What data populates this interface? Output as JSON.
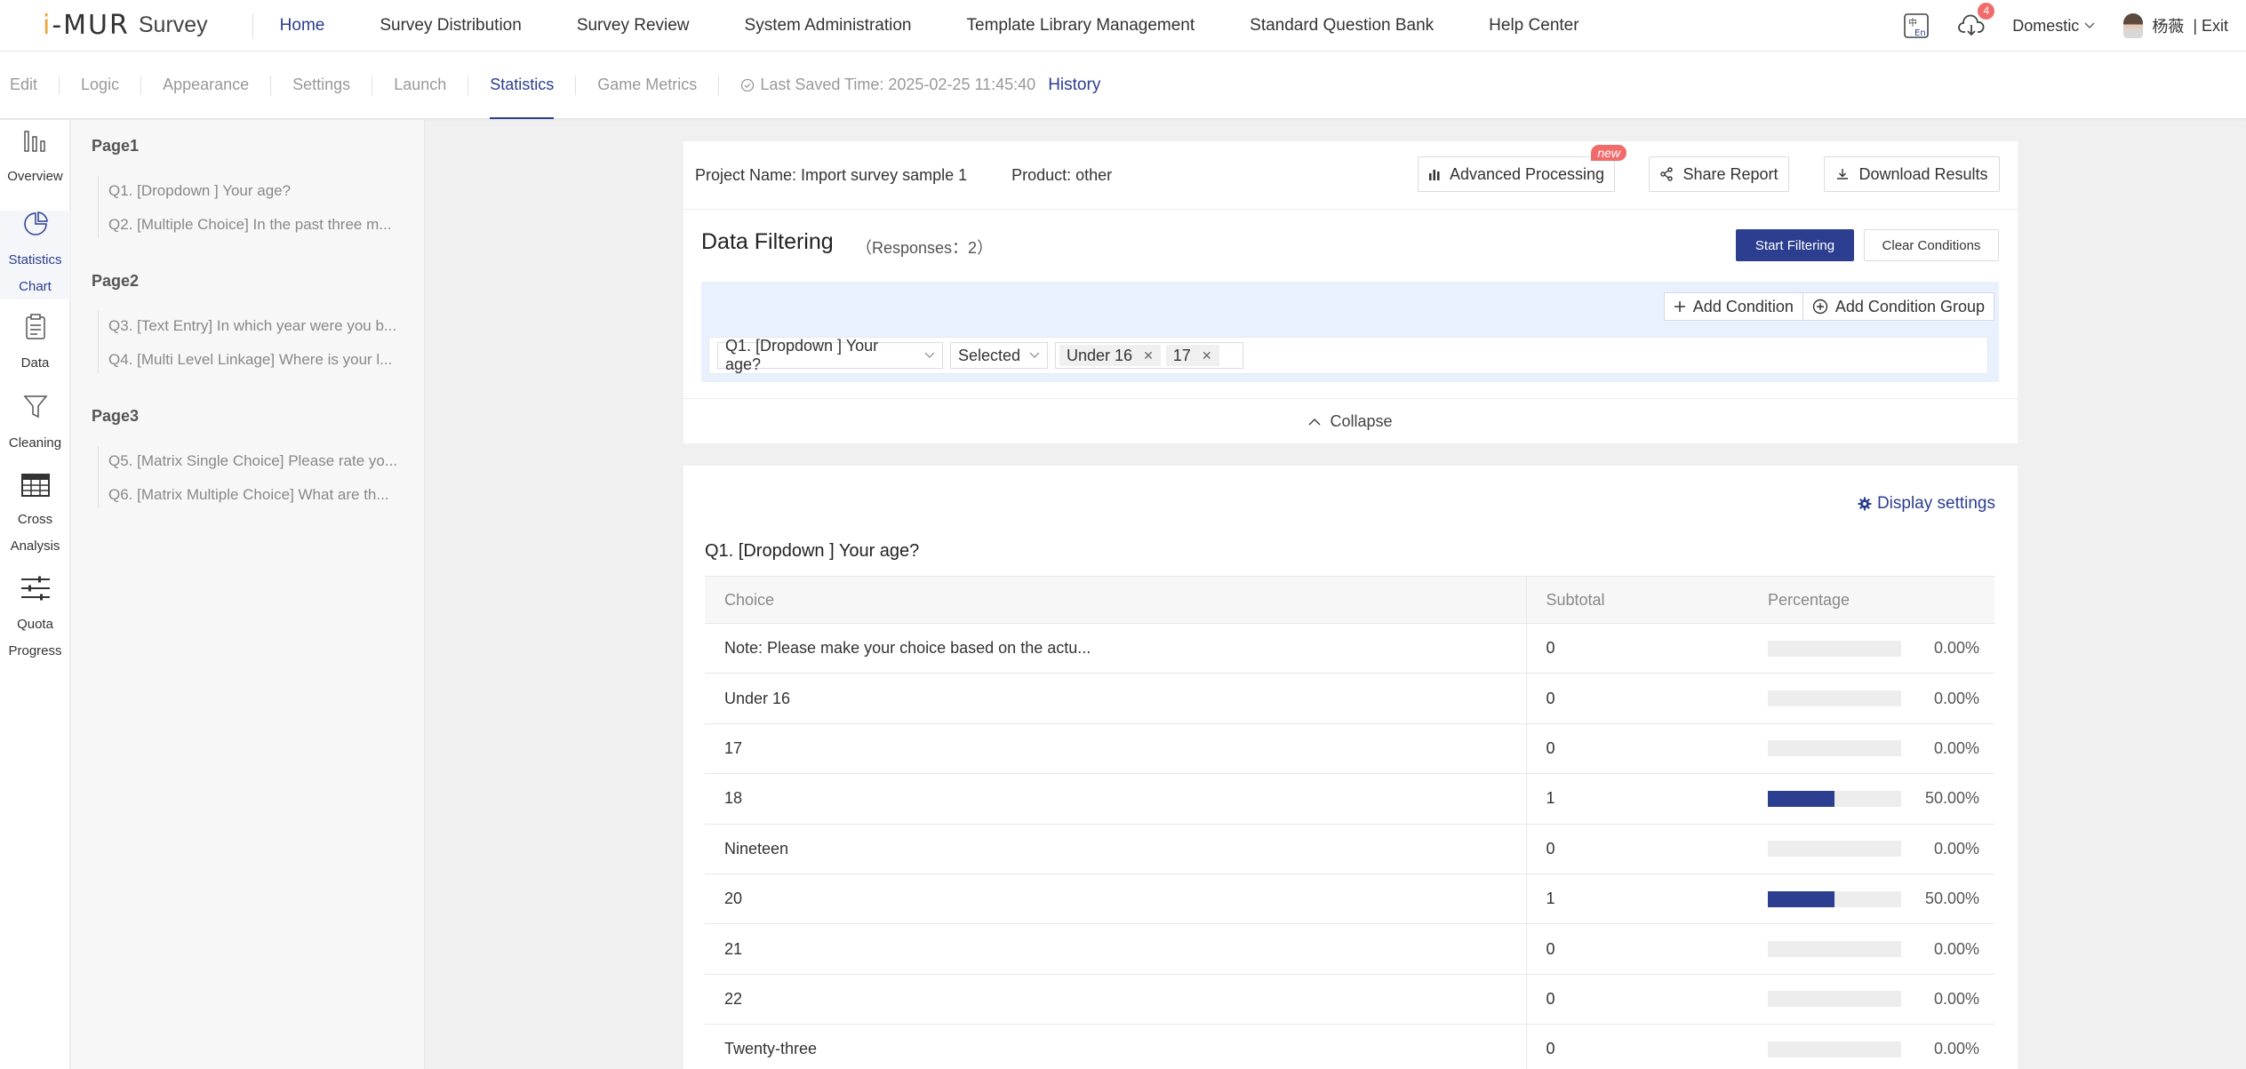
{
  "brand": {
    "logo": "i-MUR",
    "name": "Survey"
  },
  "nav": [
    "Home",
    "Survey Distribution",
    "Survey Review",
    "System Administration",
    "Template Library Management",
    "Standard Question Bank",
    "Help Center"
  ],
  "nav_active": "Home",
  "top_right": {
    "download_badge": "4",
    "region": "Domestic",
    "user": "杨薇",
    "exit": "| Exit"
  },
  "subnav": [
    "Edit",
    "Logic",
    "Appearance",
    "Settings",
    "Launch",
    "Statistics",
    "Game Metrics"
  ],
  "subnav_active": "Statistics",
  "saved": {
    "text": "Last Saved Time: 2025-02-25 11:45:40",
    "history": "History"
  },
  "rail": [
    {
      "label1": "Overview",
      "label2": "",
      "icon": "bar-columns-icon"
    },
    {
      "label1": "Statistics",
      "label2": "Chart",
      "icon": "pie-chart-icon"
    },
    {
      "label1": "Data",
      "label2": "",
      "icon": "clipboard-icon"
    },
    {
      "label1": "Cleaning",
      "label2": "",
      "icon": "funnel-icon"
    },
    {
      "label1": "Cross",
      "label2": "Analysis",
      "icon": "table-icon"
    },
    {
      "label1": "Quota",
      "label2": "Progress",
      "icon": "sliders-icon"
    }
  ],
  "pages": [
    {
      "label": "Page1",
      "questions": [
        "Q1. [Dropdown ] Your age?",
        "Q2. [Multiple Choice] In the past three m..."
      ]
    },
    {
      "label": "Page2",
      "questions": [
        "Q3. [Text Entry] In which year were you b...",
        "Q4. [Multi Level Linkage] Where is your l..."
      ]
    },
    {
      "label": "Page3",
      "questions": [
        "Q5. [Matrix Single Choice] Please rate yo...",
        "Q6. [Matrix Multiple Choice] What are th..."
      ]
    }
  ],
  "project": {
    "name": "Project Name: Import survey sample 1",
    "product": "Product: other",
    "advanced": "Advanced Processing",
    "new_badge": "new",
    "share": "Share Report",
    "download": "Download Results"
  },
  "filter": {
    "title": "Data Filtering",
    "responses": "（Responses：2）",
    "start": "Start Filtering",
    "clear": "Clear Conditions",
    "add_condition": "Add Condition",
    "add_group": "Add Condition Group",
    "question": "Q1. [Dropdown ] Your age?",
    "operator": "Selected",
    "tags": [
      "Under 16",
      "17"
    ],
    "collapse": "Collapse"
  },
  "results": {
    "display_settings": "Display settings",
    "question": "Q1. [Dropdown ] Your age?",
    "headers": [
      "Choice",
      "Subtotal",
      "Percentage"
    ],
    "rows": [
      {
        "choice": "Note: Please make your choice based on the actu...",
        "subtotal": "0",
        "pct": "0.00%",
        "fill": 0
      },
      {
        "choice": "Under 16",
        "subtotal": "0",
        "pct": "0.00%",
        "fill": 0
      },
      {
        "choice": "17",
        "subtotal": "0",
        "pct": "0.00%",
        "fill": 0
      },
      {
        "choice": "18",
        "subtotal": "1",
        "pct": "50.00%",
        "fill": 0.5
      },
      {
        "choice": "Nineteen",
        "subtotal": "0",
        "pct": "0.00%",
        "fill": 0
      },
      {
        "choice": "20",
        "subtotal": "1",
        "pct": "50.00%",
        "fill": 0.5
      },
      {
        "choice": "21",
        "subtotal": "0",
        "pct": "0.00%",
        "fill": 0
      },
      {
        "choice": "22",
        "subtotal": "0",
        "pct": "0.00%",
        "fill": 0
      },
      {
        "choice": "Twenty-three",
        "subtotal": "0",
        "pct": "0.00%",
        "fill": 0
      }
    ]
  },
  "colors": {
    "accent": "#2b3e90",
    "badge": "#f26b6b",
    "filter_bg": "#e9f1ff"
  }
}
